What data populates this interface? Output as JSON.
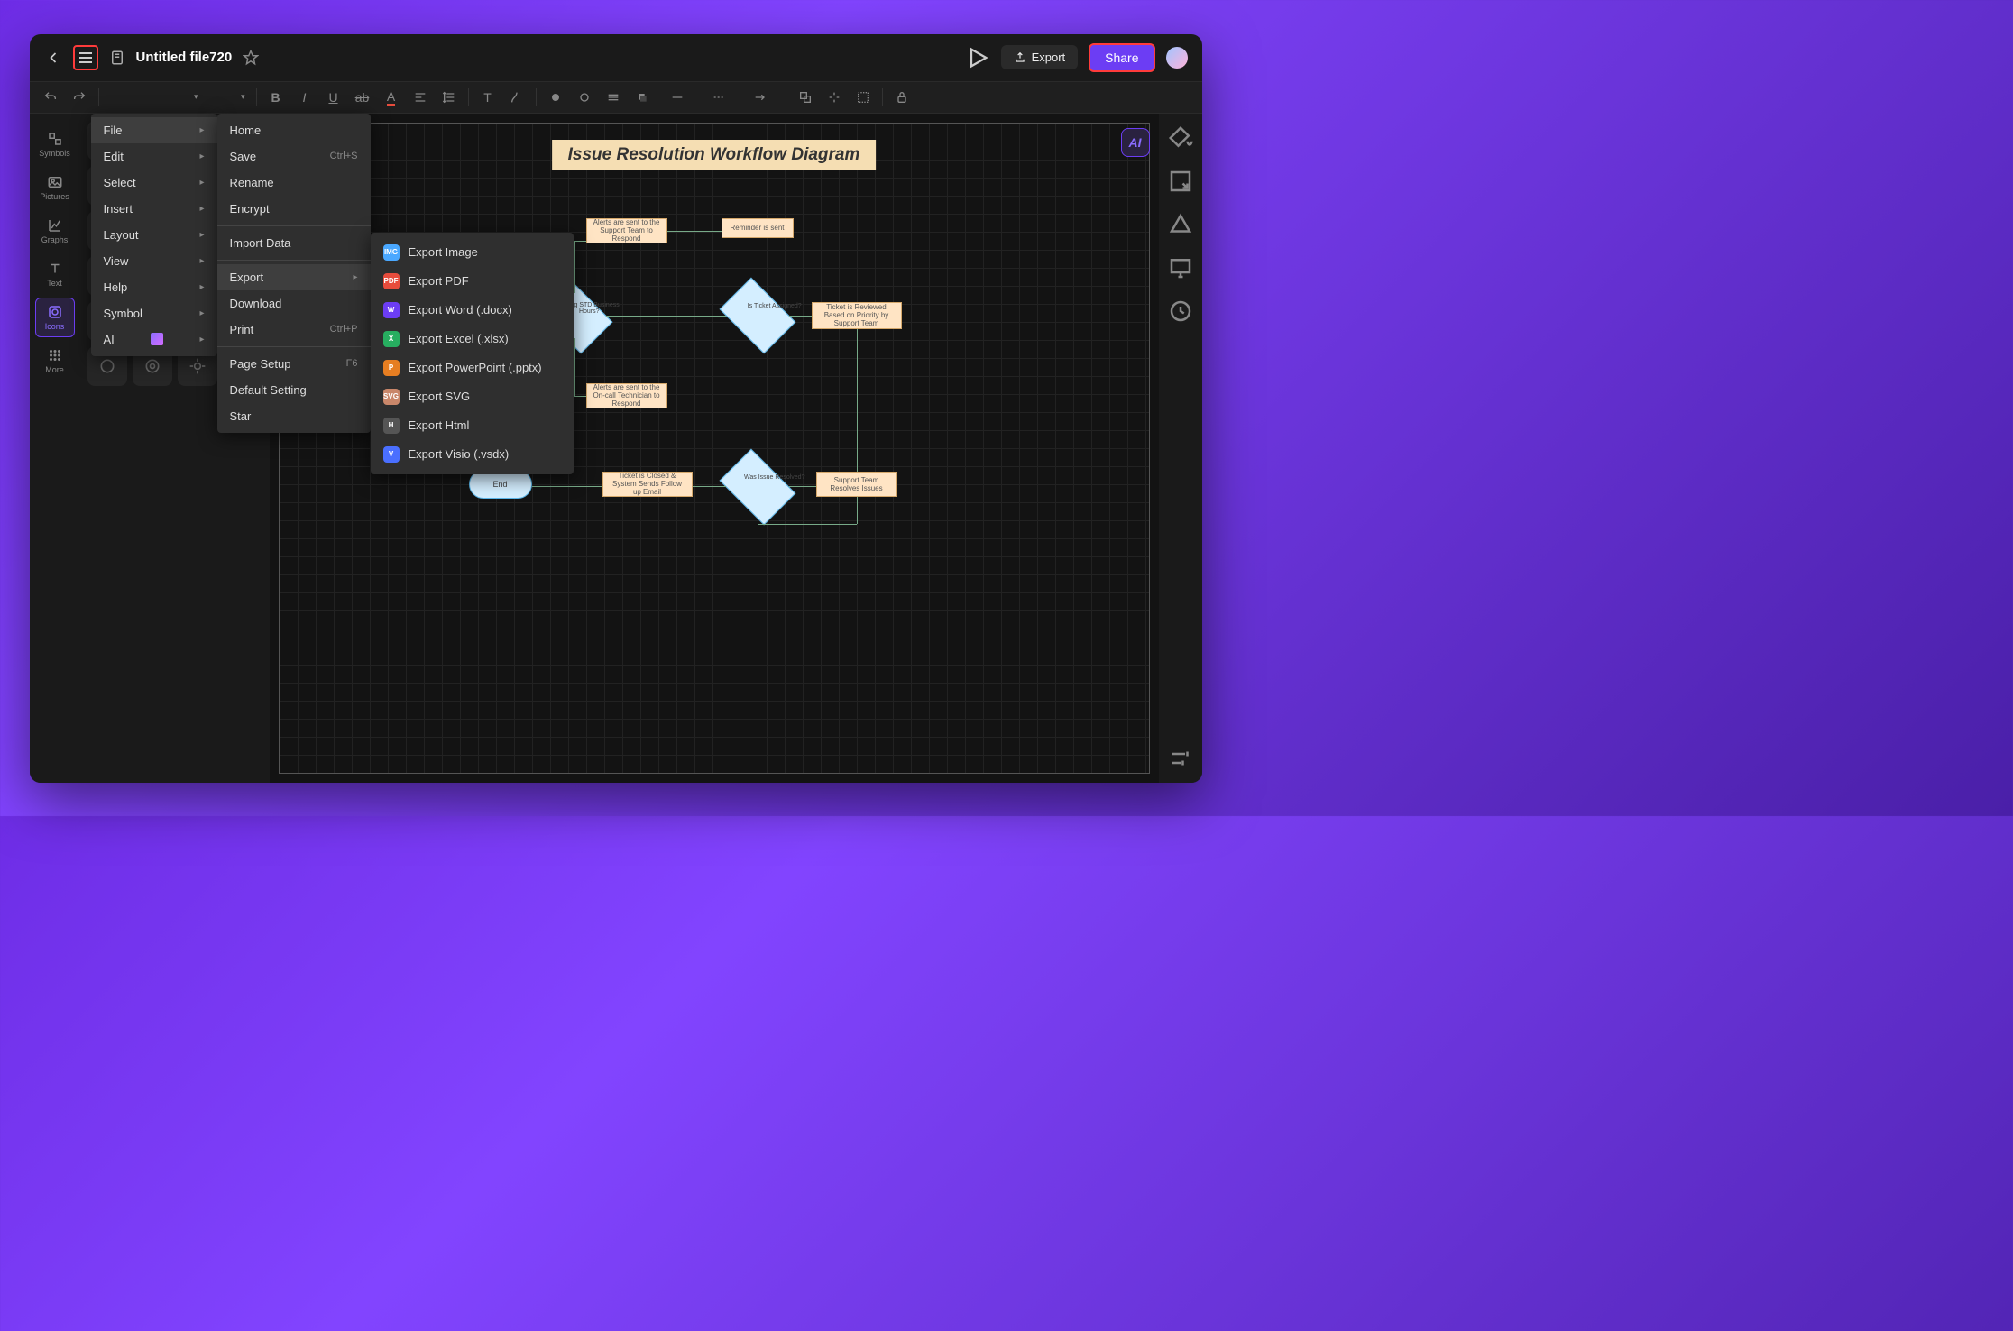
{
  "topbar": {
    "filename": "Untitled file720",
    "export_label": "Export",
    "share_label": "Share"
  },
  "left_rail": {
    "items": [
      {
        "label": "Symbols"
      },
      {
        "label": "Pictures"
      },
      {
        "label": "Graphs"
      },
      {
        "label": "Text"
      },
      {
        "label": "Icons"
      },
      {
        "label": "More"
      }
    ]
  },
  "menu1": {
    "items": [
      {
        "label": "File",
        "has_submenu": true,
        "active": true
      },
      {
        "label": "Edit",
        "has_submenu": true
      },
      {
        "label": "Select",
        "has_submenu": true
      },
      {
        "label": "Insert",
        "has_submenu": true
      },
      {
        "label": "Layout",
        "has_submenu": true
      },
      {
        "label": "View",
        "has_submenu": true
      },
      {
        "label": "Help",
        "has_submenu": true
      },
      {
        "label": "Symbol",
        "has_submenu": true
      },
      {
        "label": "AI",
        "has_submenu": true,
        "ai": true
      }
    ]
  },
  "menu2": {
    "items": [
      {
        "label": "Home"
      },
      {
        "label": "Save",
        "shortcut": "Ctrl+S"
      },
      {
        "label": "Rename"
      },
      {
        "label": "Encrypt"
      },
      {
        "divider": true
      },
      {
        "label": "Import Data"
      },
      {
        "divider": true
      },
      {
        "label": "Export",
        "has_submenu": true,
        "active": true
      },
      {
        "label": "Download"
      },
      {
        "label": "Print",
        "shortcut": "Ctrl+P"
      },
      {
        "divider": true
      },
      {
        "label": "Page Setup",
        "shortcut": "F6"
      },
      {
        "label": "Default Setting"
      },
      {
        "label": "Star"
      }
    ]
  },
  "menu3": {
    "items": [
      {
        "label": "Export Image",
        "icon_bg": "#4aa8ff",
        "icon_text": "IMG"
      },
      {
        "label": "Export PDF",
        "icon_bg": "#e74c3c",
        "icon_text": "PDF"
      },
      {
        "label": "Export Word (.docx)",
        "icon_bg": "#6c3df4",
        "icon_text": "W"
      },
      {
        "label": "Export Excel (.xlsx)",
        "icon_bg": "#27ae60",
        "icon_text": "X"
      },
      {
        "label": "Export PowerPoint (.pptx)",
        "icon_bg": "#e67e22",
        "icon_text": "P"
      },
      {
        "label": "Export SVG",
        "icon_bg": "#c9876a",
        "icon_text": "SVG"
      },
      {
        "label": "Export Html",
        "icon_bg": "#555",
        "icon_text": "H"
      },
      {
        "label": "Export Visio (.vsdx)",
        "icon_bg": "#4a6fff",
        "icon_text": "V"
      }
    ]
  },
  "diagram": {
    "title": "Issue Resolution Workflow Diagram",
    "nodes": {
      "n1": "Alerts are sent to the Support Team to Respond",
      "n2": "Reminder is sent",
      "n3": "During STD Business Hours?",
      "n4": "Is Ticket Assigned?",
      "n5": "Ticket is Reviewed Based on Priority by Support Team",
      "n6": "Alerts are sent to the On-call Technician to Respond",
      "n7": "End",
      "n8": "Ticket is Closed & System Sends Follow up Email",
      "n9": "Was Issue Resolved?",
      "n10": "Support Team Resolves Issues"
    }
  }
}
